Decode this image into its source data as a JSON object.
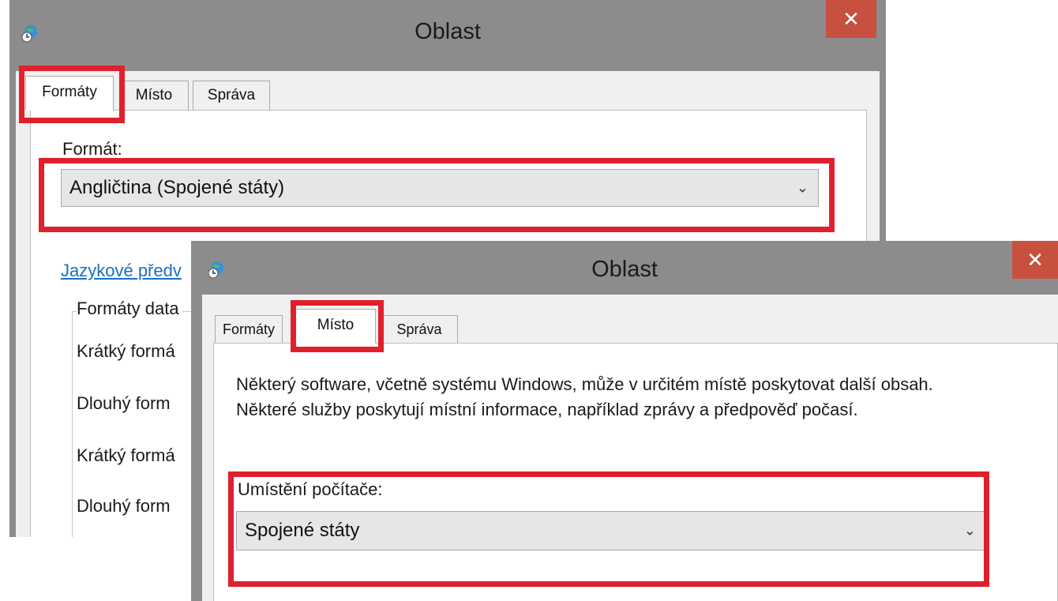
{
  "back_window": {
    "title": "Oblast",
    "close_glyph": "✕",
    "tabs": [
      {
        "label": "Formáty",
        "active": true
      },
      {
        "label": "Místo",
        "active": false
      },
      {
        "label": "Správa",
        "active": false
      }
    ],
    "format_label": "Formát:",
    "format_value": "Angličtina (Spojené státy)",
    "language_link": "Jazykové předv",
    "date_formats_group": "Formáty data",
    "rows": [
      "Krátký formá",
      "Dlouhý form",
      "Krátký formá",
      "Dlouhý form"
    ]
  },
  "front_window": {
    "title": "Oblast",
    "close_glyph": "✕",
    "tabs": [
      {
        "label": "Formáty",
        "active": false
      },
      {
        "label": "Místo",
        "active": true
      },
      {
        "label": "Správa",
        "active": false
      }
    ],
    "description": "Některý software, včetně systému Windows, může v určitém místě poskytovat další obsah. Některé služby poskytují místní informace, například zprávy a předpověď počasí.",
    "location_label": "Umístění počítače:",
    "location_value": "Spojené státy"
  },
  "icons": {
    "app": "globe-clock-icon",
    "dropdown": "chevron-down-icon",
    "close": "close-icon"
  },
  "colors": {
    "highlight": "#e0202c",
    "close_button": "#c7503f",
    "link": "#1a6fc0",
    "window_frame": "#8c8c8c"
  }
}
